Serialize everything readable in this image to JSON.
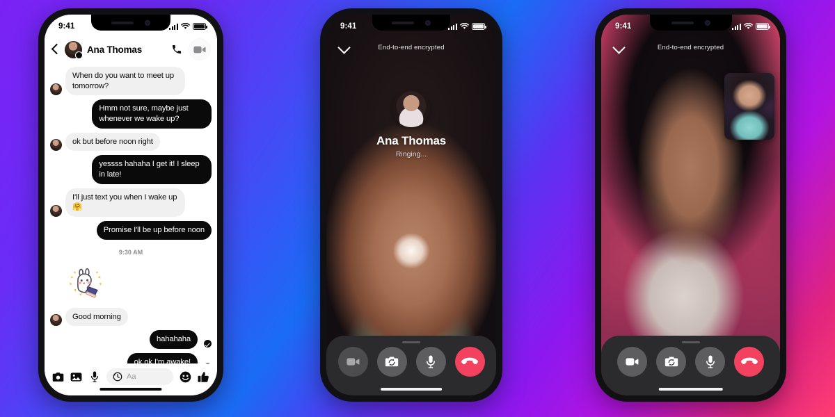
{
  "background": {
    "gradient_from": "#7b22f5",
    "gradient_mid": "#1a6cf5",
    "gradient_to": "#ff3d73"
  },
  "phones": {
    "chat": {
      "status_bar": {
        "time": "9:41",
        "signal_icon": "signal-bars-icon",
        "wifi_icon": "wifi-icon",
        "battery_icon": "battery-icon"
      },
      "header": {
        "back_icon": "chevron-left-icon",
        "avatar": "contact-avatar",
        "name": "Ana Thomas",
        "call_icon": "phone-icon",
        "video_icon": "video-camera-icon"
      },
      "messages": [
        {
          "id": "m1",
          "side": "in",
          "text": "When do you want to meet up tomorrow?",
          "avatar": true
        },
        {
          "id": "m2",
          "side": "out",
          "text": "Hmm not sure, maybe just whenever we wake up?"
        },
        {
          "id": "m3",
          "side": "in",
          "text": "ok but before noon right",
          "avatar": true
        },
        {
          "id": "m4",
          "side": "out",
          "text": "yessss hahaha I get it! I sleep in late!"
        },
        {
          "id": "m5",
          "side": "in",
          "text": "I'll just text you when I wake up 🤗",
          "avatar": true
        },
        {
          "id": "m6",
          "side": "out",
          "text": "Promise I'll be up before noon"
        }
      ],
      "timestamp": "9:30 AM",
      "sticker": {
        "name": "bunny-sticker",
        "label": "waving bunny sticker"
      },
      "messages_after": [
        {
          "id": "m7",
          "side": "in",
          "text": "Good morning",
          "avatar": true
        },
        {
          "id": "m8",
          "side": "out",
          "text": "hahahaha",
          "seen": true
        },
        {
          "id": "m9",
          "side": "out",
          "text": "ok ok I'm awake!",
          "seen": true
        }
      ],
      "composer": {
        "camera_icon": "camera-icon",
        "gallery_icon": "photo-gallery-icon",
        "mic_icon": "microphone-icon",
        "history_icon": "clock-history-icon",
        "placeholder": "Aa",
        "emoji_icon": "smiley-icon",
        "like_icon": "thumbs-up-icon"
      }
    },
    "outgoing_call": {
      "status_bar": {
        "time": "9:41",
        "signal_icon": "signal-bars-icon",
        "wifi_icon": "wifi-icon",
        "battery_icon": "battery-icon"
      },
      "minimize_icon": "chevron-down-icon",
      "encryption_label": "End-to-end encrypted",
      "callee_name": "Ana Thomas",
      "callee_status": "Ringing...",
      "controls": [
        {
          "id": "video",
          "icon": "video-camera-icon",
          "state": "off"
        },
        {
          "id": "flip",
          "icon": "flip-camera-icon",
          "state": "on"
        },
        {
          "id": "mic",
          "icon": "microphone-icon",
          "state": "on"
        },
        {
          "id": "end",
          "icon": "end-call-icon",
          "state": "end",
          "color": "#f3425f"
        }
      ]
    },
    "active_call": {
      "status_bar": {
        "time": "9:41",
        "signal_icon": "signal-bars-icon",
        "wifi_icon": "wifi-icon",
        "battery_icon": "battery-icon"
      },
      "minimize_icon": "chevron-down-icon",
      "encryption_label": "End-to-end encrypted",
      "pip_label": "self-view",
      "controls": [
        {
          "id": "video",
          "icon": "video-camera-icon",
          "state": "on"
        },
        {
          "id": "flip",
          "icon": "flip-camera-icon",
          "state": "on"
        },
        {
          "id": "mic",
          "icon": "microphone-icon",
          "state": "on"
        },
        {
          "id": "end",
          "icon": "end-call-icon",
          "state": "end",
          "color": "#f3425f"
        }
      ]
    }
  }
}
